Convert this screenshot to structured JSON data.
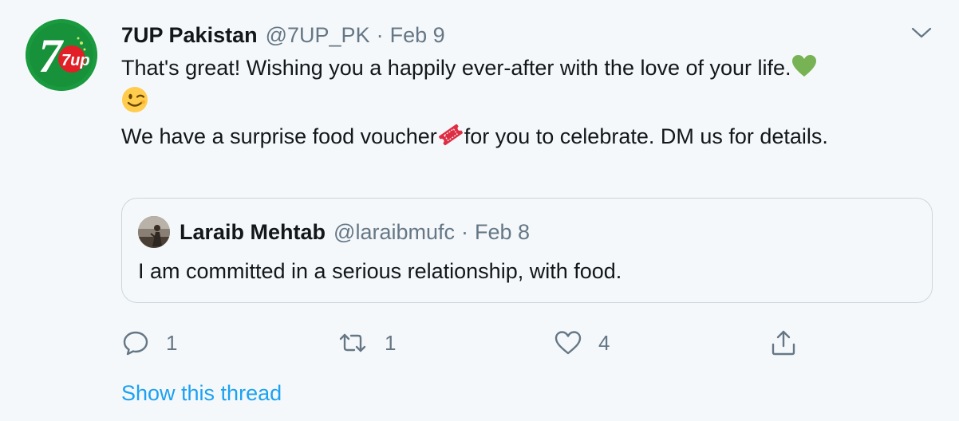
{
  "tweet": {
    "author": {
      "name": "7UP Pakistan",
      "handle": "@7UP_PK",
      "avatar_icon": "7up-logo-icon",
      "avatar_text": "7up"
    },
    "separator": "·",
    "date": "Feb 9",
    "menu_icon": "chevron-down-icon",
    "text_line1": "That's great! Wishing you a happily ever-after with the love of your life.",
    "text_para2_a": "We have a surprise food voucher",
    "text_para2_b": "for you to celebrate. DM us for details.",
    "emojis": [
      "green-heart-icon",
      "winking-face-icon",
      "ticket-icon"
    ]
  },
  "quoted_tweet": {
    "author": {
      "name": "Laraib Mehtab",
      "handle": "@laraibmufc",
      "avatar_icon": "user-avatar-icon"
    },
    "separator": "·",
    "date": "Feb 8",
    "text": "I am committed in a serious relationship, with food."
  },
  "actions": {
    "reply": {
      "icon": "reply-icon",
      "count": "1"
    },
    "retweet": {
      "icon": "retweet-icon",
      "count": "1"
    },
    "like": {
      "icon": "heart-icon",
      "count": "4"
    },
    "share": {
      "icon": "share-icon"
    }
  },
  "show_thread": "Show this thread",
  "colors": {
    "background": "#f5f8fa",
    "text": "#14171a",
    "secondary_text": "#657786",
    "link": "#1da1f2",
    "border": "#ccd6dd",
    "brand_green": "#1a9a3f",
    "brand_red": "#e21f26"
  }
}
